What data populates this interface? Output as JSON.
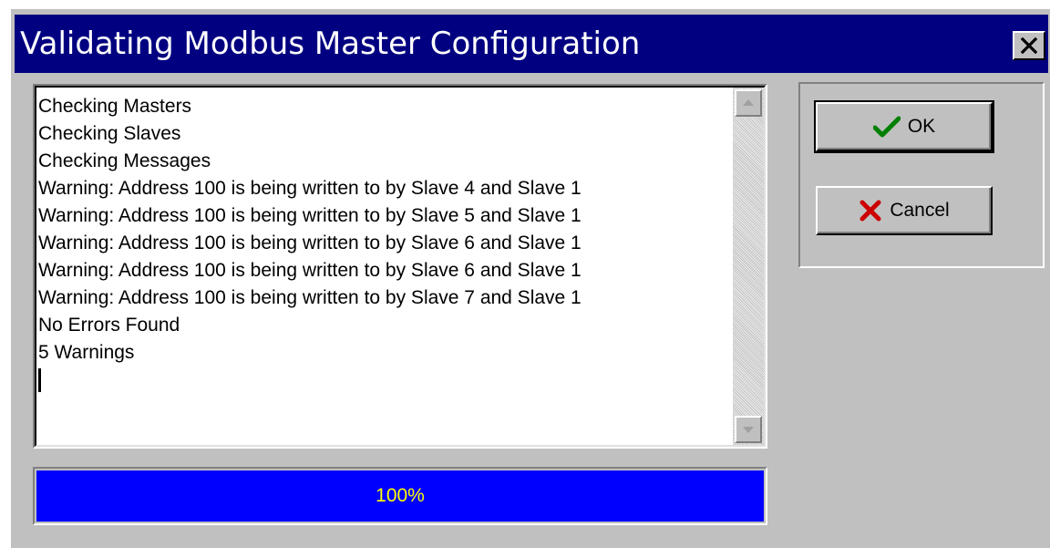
{
  "dialog": {
    "title": "Validating Modbus Master Configuration",
    "close_label": "×"
  },
  "log": {
    "lines": [
      "Checking Masters",
      "Checking Slaves",
      "Checking Messages",
      "Warning: Address 100 is being written to by Slave 4 and Slave 1",
      "Warning: Address 100 is being written to by Slave 5 and Slave 1",
      "Warning: Address 100 is being written to by Slave 6 and Slave 1",
      "Warning: Address 100 is being written to by Slave 6 and Slave 1",
      "Warning: Address 100 is being written to by Slave 7 and Slave 1",
      "No Errors Found",
      "5 Warnings"
    ]
  },
  "progress": {
    "percent": 100,
    "label": "100%"
  },
  "buttons": {
    "ok_label": "OK",
    "cancel_label": "Cancel"
  },
  "colors": {
    "title_bar": "#000080",
    "progress_fill": "#0000ff",
    "progress_text": "#ffff00",
    "ok_check": "#008000",
    "cancel_x": "#cc0000",
    "face": "#c0c0c0"
  },
  "icons": {
    "close": "close-icon",
    "ok": "checkmark-icon",
    "cancel": "x-mark-icon",
    "scroll_up": "arrow-up-icon",
    "scroll_down": "arrow-down-icon"
  }
}
